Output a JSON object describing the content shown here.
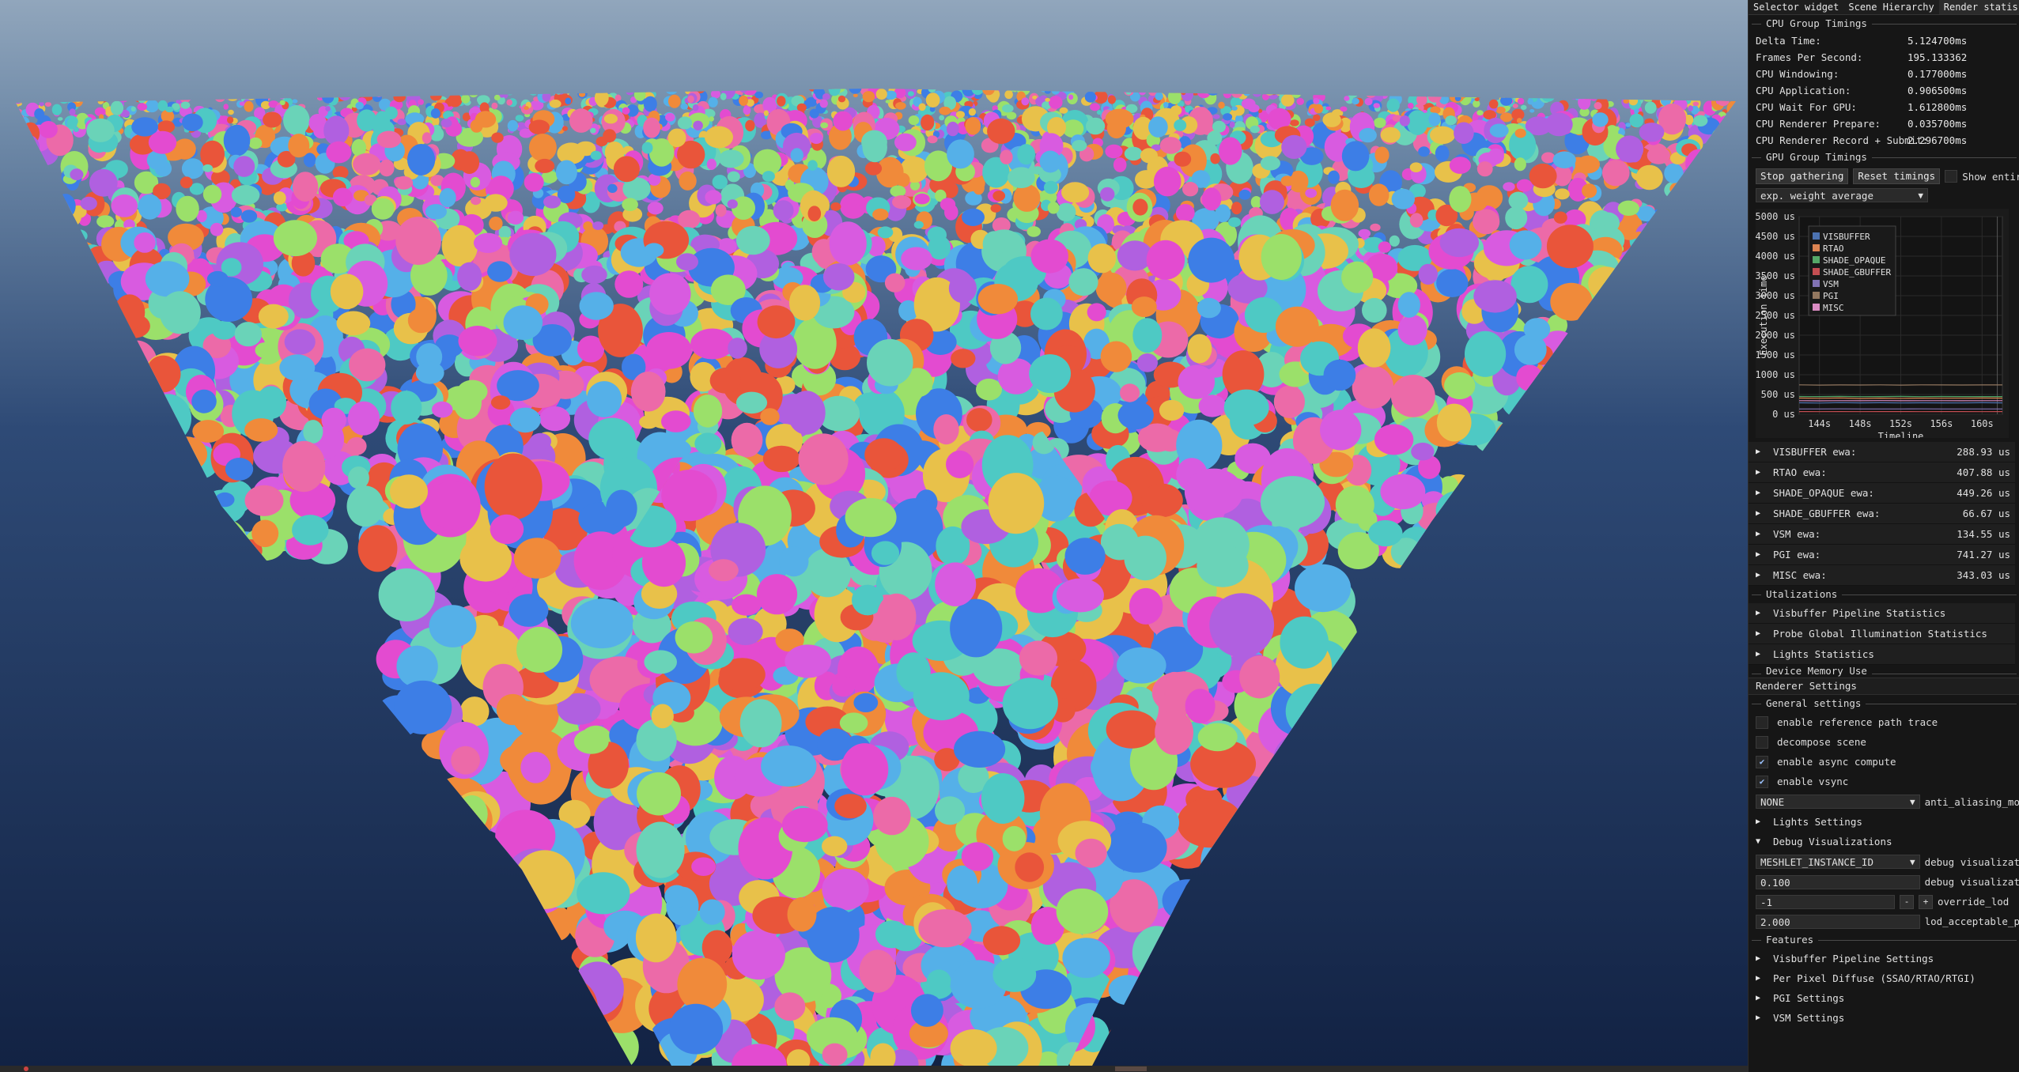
{
  "tabs": [
    "Selector widget",
    "Scene Hierarchy",
    "Render statis..."
  ],
  "cpu": {
    "header": "CPU Group Timings",
    "rows": [
      {
        "k": "Delta Time:",
        "v": "5.124700ms"
      },
      {
        "k": "Frames Per Second:",
        "v": "195.133362"
      },
      {
        "k": "CPU Windowing:",
        "v": "0.177000ms"
      },
      {
        "k": "CPU Application:",
        "v": "0.906500ms"
      },
      {
        "k": "CPU Wait For GPU:",
        "v": "1.612800ms"
      },
      {
        "k": "CPU Renderer Prepare:",
        "v": "0.035700ms"
      },
      {
        "k": "CPU Renderer Record + Submit:",
        "v": "2.296700ms"
      }
    ]
  },
  "gpu": {
    "header": "GPU Group Timings",
    "stop_label": "Stop gathering",
    "reset_label": "Reset timings",
    "show_entire_label": "Show entire mea",
    "average_mode": "exp. weight average"
  },
  "colors": {
    "VISBUFFER": "#4c72b0",
    "RTAO": "#dd8452",
    "SHADE_OPAQUE": "#55a868",
    "SHADE_GBUFFER": "#c44e52",
    "VSM": "#8172b3",
    "PGI": "#937860",
    "MISC": "#da8bc3"
  },
  "chart_data": {
    "type": "line",
    "ylabel": "Execution time",
    "xlabel": "Timeline",
    "ylim": [
      0,
      5000
    ],
    "yticks": [
      "5000 us",
      "4500 us",
      "4000 us",
      "3500 us",
      "3000 us",
      "2500 us",
      "2000 us",
      "1500 us",
      "1000 us",
      "500 us",
      "0 us"
    ],
    "xticks": [
      "144s",
      "148s",
      "152s",
      "156s",
      "160s"
    ],
    "xlim": [
      142,
      162
    ],
    "grid": true,
    "legend": "top-left",
    "series": [
      {
        "name": "VISBUFFER",
        "values": [
          290,
          285,
          295,
          288,
          292,
          286,
          290,
          289,
          287,
          291,
          288
        ]
      },
      {
        "name": "RTAO",
        "values": [
          410,
          405,
          412,
          400,
          408,
          404,
          409,
          407,
          406,
          410,
          408
        ]
      },
      {
        "name": "SHADE_OPAQUE",
        "values": [
          450,
          448,
          452,
          446,
          449,
          451,
          447,
          450,
          449,
          448,
          449
        ]
      },
      {
        "name": "SHADE_GBUFFER",
        "values": [
          67,
          66,
          68,
          66,
          67,
          67,
          66,
          67,
          67,
          66,
          67
        ]
      },
      {
        "name": "VSM",
        "values": [
          135,
          133,
          136,
          134,
          135,
          134,
          136,
          135,
          134,
          135,
          135
        ]
      },
      {
        "name": "PGI",
        "values": [
          745,
          738,
          742,
          740,
          744,
          739,
          743,
          741,
          740,
          742,
          741
        ]
      },
      {
        "name": "MISC",
        "values": [
          345,
          340,
          344,
          342,
          346,
          341,
          343,
          344,
          342,
          343,
          343
        ]
      }
    ]
  },
  "ewa": [
    {
      "label": "VISBUFFER ewa:",
      "value": "288.93 us"
    },
    {
      "label": "RTAO ewa:",
      "value": "407.88 us"
    },
    {
      "label": "SHADE_OPAQUE ewa:",
      "value": "449.26 us"
    },
    {
      "label": "SHADE_GBUFFER ewa:",
      "value": "66.67 us"
    },
    {
      "label": "VSM ewa:",
      "value": "134.55 us"
    },
    {
      "label": "PGI ewa:",
      "value": "741.27 us"
    },
    {
      "label": "MISC ewa:",
      "value": "343.03 us"
    }
  ],
  "utilizations": {
    "header": "Utalizations",
    "items": [
      "Visbuffer Pipeline Statistics",
      "Probe Global Illumination Statistics",
      "Lights Statistics"
    ]
  },
  "device_memory_header": "Device Memory Use",
  "renderer_settings": {
    "title": "Renderer Settings",
    "general_header": "General settings",
    "checkboxes": [
      {
        "label": "enable reference path trace",
        "checked": false
      },
      {
        "label": "decompose scene",
        "checked": false
      },
      {
        "label": "enable async compute",
        "checked": true
      },
      {
        "label": "enable vsync",
        "checked": true
      }
    ],
    "aa_value": "NONE",
    "aa_label": "anti_aliasing_mo",
    "lights_settings": "Lights Settings",
    "debug_visualizations": "Debug Visualizations",
    "debug_combo_value": "MESHLET_INSTANCE_ID",
    "debug_combo_label": "debug visualizat",
    "debug_float_value": "0.100",
    "debug_float_label": "debug visualizat",
    "override_lod_value": "-1",
    "override_lod_label": "override_lod",
    "minus": "-",
    "plus": "+",
    "lod_value": "2.000",
    "lod_label": "lod_acceptable_p",
    "features_header": "Features",
    "features": [
      "Visbuffer Pipeline Settings",
      "Per Pixel Diffuse (SSAO/RTAO/RTGI)",
      "PGI Settings",
      "VSM Settings"
    ]
  }
}
